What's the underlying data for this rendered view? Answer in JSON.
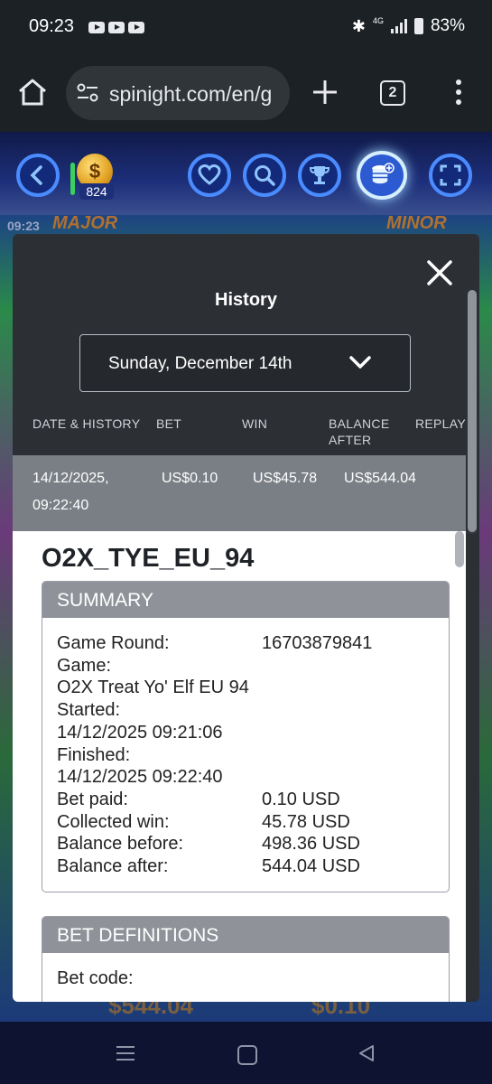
{
  "status": {
    "time": "09:23",
    "network": "4G",
    "battery": "83%"
  },
  "browser": {
    "url": "spinight.com/en/g",
    "tab_count": "2"
  },
  "game": {
    "coin_count": "824",
    "clock": "09:23",
    "jackpot_left": "MAJOR",
    "jackpot_right": "MINOR",
    "balance_ghost": "$544.04",
    "bet_ghost": "$0.10"
  },
  "history": {
    "title": "History",
    "date_label": "Sunday, December 14th",
    "columns": {
      "date": "DATE & HISTORY",
      "bet": "BET",
      "win": "WIN",
      "balance": "BALANCE AFTER",
      "balance_line1": "BALANCE",
      "balance_line2": "AFTER",
      "replay": "REPLAY"
    },
    "row": {
      "date": "14/12/2025,",
      "time": "09:22:40",
      "bet": "US$0.10",
      "win": "US$45.78",
      "balance": "US$544.04"
    }
  },
  "detail": {
    "game_id": "O2X_TYE_EU_94",
    "summary": {
      "heading": "SUMMARY",
      "game_round_label": "Game Round:",
      "game_round_value": "16703879841",
      "game_label": "Game:",
      "game_value": "O2X Treat Yo' Elf EU 94",
      "started_label": "Started:",
      "started_value": "14/12/2025 09:21:06",
      "finished_label": "Finished:",
      "finished_value": "14/12/2025 09:22:40",
      "bet_paid_label": "Bet paid:",
      "bet_paid_value": "0.10 USD",
      "collected_win_label": "Collected win:",
      "collected_win_value": "45.78 USD",
      "balance_before_label": "Balance before:",
      "balance_before_value": "498.36 USD",
      "balance_after_label": "Balance after:",
      "balance_after_value": "544.04 USD"
    },
    "bet_definitions": {
      "heading": "BET DEFINITIONS",
      "bet_code_label": "Bet code:"
    }
  },
  "icons": {
    "back": "chevron-left-icon",
    "favorite": "heart-icon",
    "search": "search-icon",
    "trophy": "trophy-icon",
    "history": "coins-history-icon",
    "fullscreen": "fullscreen-icon"
  }
}
